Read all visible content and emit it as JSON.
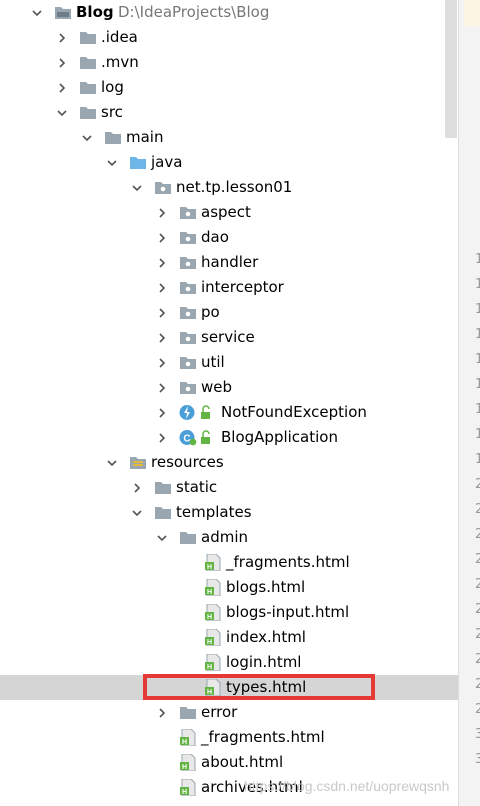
{
  "project": {
    "name": "Blog",
    "path": "D:\\IdeaProjects\\Blog"
  },
  "tree": [
    {
      "label": "Blog",
      "bold": true,
      "path": "D:\\IdeaProjects\\Blog",
      "level": 0,
      "expanded": true,
      "icon": "project-folder-icon"
    },
    {
      "label": ".idea",
      "level": 1,
      "expanded": false,
      "icon": "folder-icon"
    },
    {
      "label": ".mvn",
      "level": 1,
      "expanded": false,
      "icon": "folder-icon"
    },
    {
      "label": "log",
      "level": 1,
      "expanded": false,
      "icon": "folder-icon"
    },
    {
      "label": "src",
      "level": 1,
      "expanded": true,
      "icon": "folder-icon"
    },
    {
      "label": "main",
      "level": 2,
      "expanded": true,
      "icon": "folder-icon"
    },
    {
      "label": "java",
      "level": 3,
      "expanded": true,
      "icon": "source-folder-icon"
    },
    {
      "label": "net.tp.lesson01",
      "level": 4,
      "expanded": true,
      "icon": "package-icon"
    },
    {
      "label": "aspect",
      "level": 5,
      "expanded": false,
      "icon": "package-icon"
    },
    {
      "label": "dao",
      "level": 5,
      "expanded": false,
      "icon": "package-icon"
    },
    {
      "label": "handler",
      "level": 5,
      "expanded": false,
      "icon": "package-icon"
    },
    {
      "label": "interceptor",
      "level": 5,
      "expanded": false,
      "icon": "package-icon"
    },
    {
      "label": "po",
      "level": 5,
      "expanded": false,
      "icon": "package-icon"
    },
    {
      "label": "service",
      "level": 5,
      "expanded": false,
      "icon": "package-icon"
    },
    {
      "label": "util",
      "level": 5,
      "expanded": false,
      "icon": "package-icon"
    },
    {
      "label": "web",
      "level": 5,
      "expanded": false,
      "icon": "package-icon"
    },
    {
      "label": "NotFoundException",
      "level": 5,
      "expanded": false,
      "icon": "exception-class-icon"
    },
    {
      "label": "BlogApplication",
      "level": 5,
      "expanded": false,
      "icon": "spring-class-icon"
    },
    {
      "label": "resources",
      "level": 3,
      "expanded": true,
      "icon": "resources-folder-icon"
    },
    {
      "label": "static",
      "level": 4,
      "expanded": false,
      "icon": "folder-icon"
    },
    {
      "label": "templates",
      "level": 4,
      "expanded": true,
      "icon": "folder-icon"
    },
    {
      "label": "admin",
      "level": 5,
      "expanded": true,
      "icon": "folder-icon"
    },
    {
      "label": "_fragments.html",
      "level": 6,
      "icon": "html-file-icon"
    },
    {
      "label": "blogs.html",
      "level": 6,
      "icon": "html-file-icon"
    },
    {
      "label": "blogs-input.html",
      "level": 6,
      "icon": "html-file-icon"
    },
    {
      "label": "index.html",
      "level": 6,
      "icon": "html-file-icon"
    },
    {
      "label": "login.html",
      "level": 6,
      "icon": "html-file-icon"
    },
    {
      "label": "types.html",
      "level": 6,
      "icon": "html-file-icon",
      "selected": true
    },
    {
      "label": "error",
      "level": 5,
      "expanded": false,
      "icon": "folder-icon"
    },
    {
      "label": "_fragments.html",
      "level": 5,
      "icon": "html-file-icon"
    },
    {
      "label": "about.html",
      "level": 5,
      "icon": "html-file-icon"
    },
    {
      "label": "archives.html",
      "level": 5,
      "icon": "html-file-icon"
    }
  ],
  "gutter_numbers": [
    "1",
    "1",
    "1",
    "1",
    "1",
    "1",
    "1",
    "1",
    "1",
    "2",
    "2",
    "2",
    "2",
    "2",
    "2",
    "2",
    "2",
    "2",
    "2",
    "3",
    "3"
  ],
  "watermark": "https://blog.csdn.net/uoprewqsnh",
  "colors": {
    "selection": "#d5d5d5",
    "highlight_box": "#e53935",
    "folder": "#9aa7b0",
    "source_folder": "#6cb6e8",
    "html_icon": "#62b543"
  }
}
